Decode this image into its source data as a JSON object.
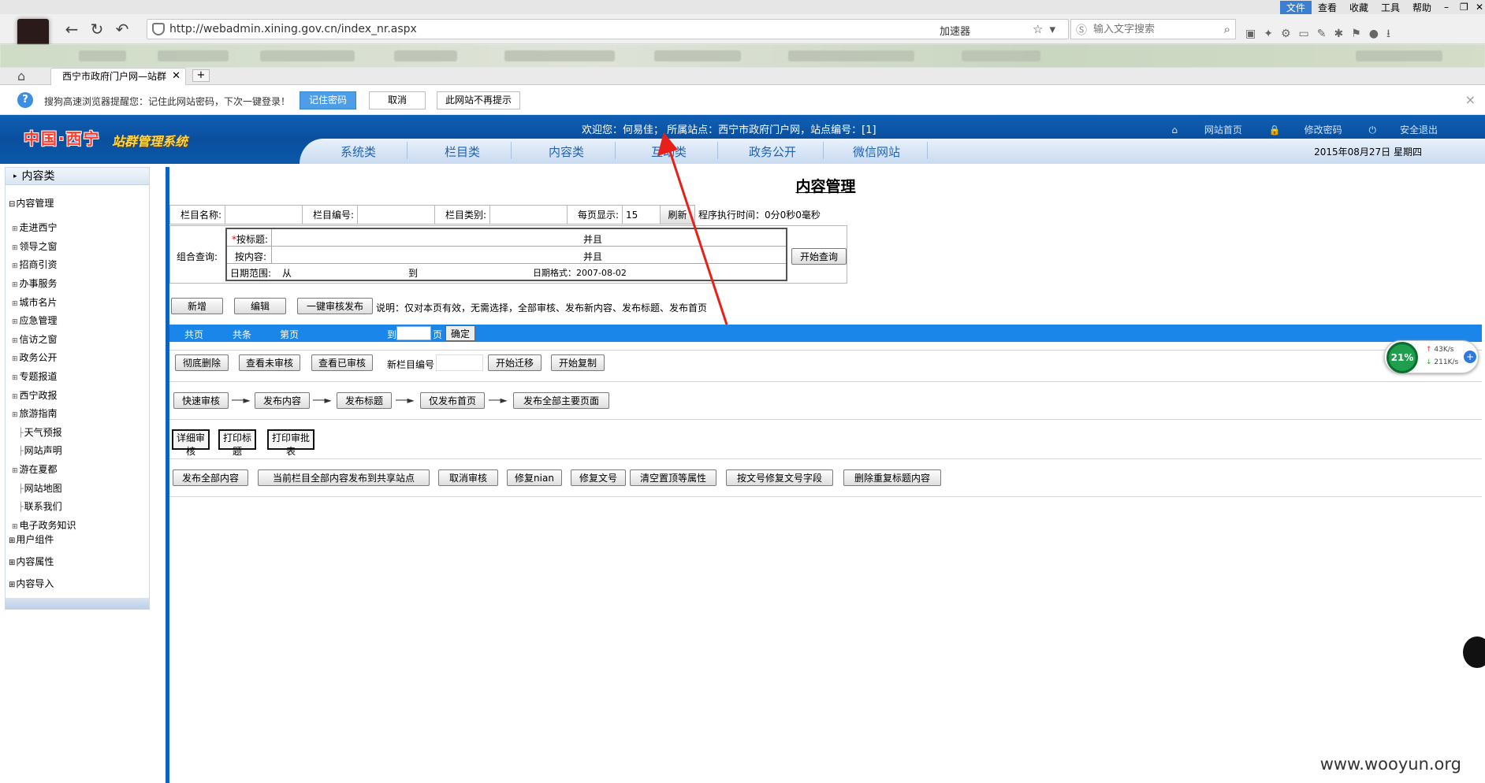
{
  "browser": {
    "menus": [
      "文件",
      "查看",
      "收藏",
      "工具",
      "帮助"
    ],
    "url": "http://webadmin.xining.gov.cn/index_nr.aspx",
    "accelerator": "加速器",
    "search_placeholder": "输入文字搜索",
    "tab_title": "西宁市政府门户网—站群",
    "password_bar": {
      "message": "搜狗高速浏览器提醒您：记住此网站密码，下次一键登录！",
      "remember": "记住密码",
      "cancel": "取消",
      "never": "此网站不再提示"
    }
  },
  "header": {
    "logo": "中国·西宁",
    "system_name": "站群管理系统",
    "welcome_prefix": "欢迎您：",
    "user": "何易佳",
    "site_info": "；  所属站点：西宁市政府门户网，站点编号：[1]",
    "links": [
      "网站首页",
      "修改密码",
      "安全退出"
    ],
    "menu": [
      "系统类",
      "栏目类",
      "内容类",
      "互动类",
      "政务公开",
      "微信网站"
    ],
    "date": "2015年08月27日 星期四"
  },
  "sidebar": {
    "title": "内容类",
    "group_main": "内容管理",
    "nodes": [
      {
        "label": "走进西宁",
        "type": "plus"
      },
      {
        "label": "领导之窗",
        "type": "plus"
      },
      {
        "label": "招商引资",
        "type": "plus"
      },
      {
        "label": "办事服务",
        "type": "plus"
      },
      {
        "label": "城市名片",
        "type": "plus"
      },
      {
        "label": "应急管理",
        "type": "plus"
      },
      {
        "label": "信访之窗",
        "type": "plus"
      },
      {
        "label": "政务公开",
        "type": "plus"
      },
      {
        "label": "专题报道",
        "type": "plus"
      },
      {
        "label": "西宁政报",
        "type": "plus"
      },
      {
        "label": "旅游指南",
        "type": "plus"
      },
      {
        "label": "天气预报",
        "type": "leaf"
      },
      {
        "label": "网站声明",
        "type": "leaf"
      },
      {
        "label": "游在夏都",
        "type": "plus"
      },
      {
        "label": "网站地图",
        "type": "leaf"
      },
      {
        "label": "联系我们",
        "type": "leaf"
      },
      {
        "label": "电子政务知识",
        "type": "plus"
      }
    ],
    "groups": [
      "用户组件",
      "内容属性",
      "内容导入"
    ]
  },
  "main": {
    "title": "内容管理",
    "query": {
      "col_name": "栏目名称:",
      "col_id": "栏目编号:",
      "col_type": "栏目类别:",
      "per_page_label": "每页显示:",
      "per_page": "15",
      "refresh": "刷新",
      "exec_time": "程序执行时间：0分0秒0毫秒",
      "combo_label": "组合查询:",
      "by_title": "按标题:",
      "by_content": "按内容:",
      "and1": "并且",
      "and2": "并且",
      "date_range": "日期范围:",
      "from": "从",
      "to": "到",
      "date_format": "日期格式：2007-08-02",
      "start_query": "开始查询"
    },
    "actions": {
      "add": "新增",
      "edit": "编辑",
      "one_click": "一键审核发布",
      "note": "说明：仅对本页有效，无需选择，全部审核、发布新内容、发布标题、发布首页"
    },
    "pager": {
      "total_pages": "共页",
      "total_items": "共条",
      "page_no": "第页",
      "goto": "到",
      "page": "页",
      "ok": "确定"
    },
    "row2": {
      "delete": "彻底删除",
      "view_unreviewed": "查看未审核",
      "view_reviewed": "查看已审核",
      "new_col_id": "新栏目编号",
      "start_move": "开始迁移",
      "start_copy": "开始复制"
    },
    "flow": [
      "快速审核",
      "发布内容",
      "发布标题",
      "仅发布首页",
      "发布全部主要页面"
    ],
    "print": [
      "详细审核",
      "打印标题",
      "打印审批表"
    ],
    "row5": [
      "发布全部内容",
      "当前栏目全部内容发布到共享站点",
      "取消审核",
      "修复nian",
      "修复文号",
      "清空置顶等属性",
      "按文号修复文号字段",
      "删除重复标题内容"
    ]
  },
  "net_widget": {
    "percent": "21%",
    "up": "43K/s",
    "down": "211K/s"
  },
  "watermark": "www.wooyun.org",
  "colors": {
    "header_blue": "#0b58ab",
    "pager_blue": "#1a86ea",
    "annotation_red": "#e8201a"
  }
}
